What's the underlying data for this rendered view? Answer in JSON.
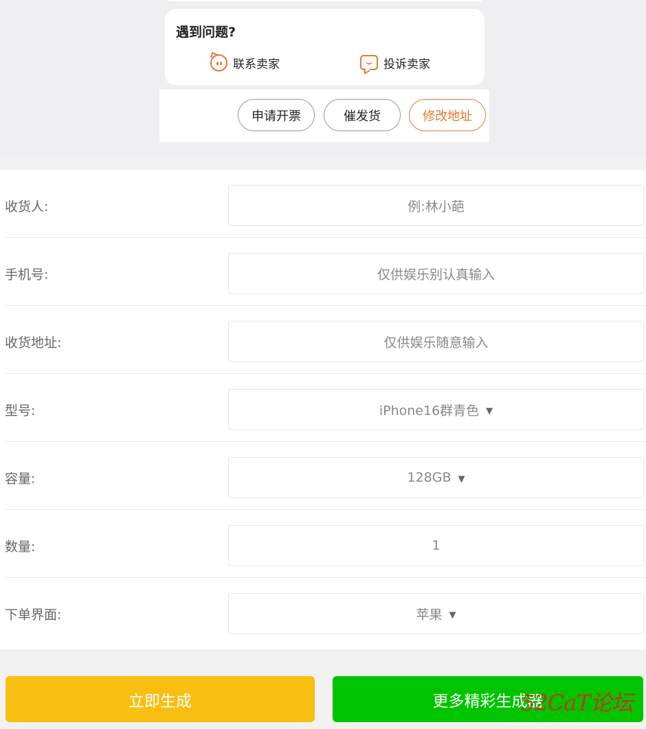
{
  "preview": {
    "problem_title": "遇到问题?",
    "contact_seller": "联系卖家",
    "complain_seller": "投诉卖家",
    "buttons": {
      "invoice": "申请开票",
      "urge": "催发货",
      "address": "修改地址"
    }
  },
  "form": {
    "rows": [
      {
        "label": "收货人:",
        "value": "例:林小葩"
      },
      {
        "label": "手机号:",
        "value": "仅供娱乐别认真输入"
      },
      {
        "label": "收货地址:",
        "value": "仅供娱乐随意输入"
      },
      {
        "label": "型号:",
        "value": "iPhone16群青色"
      },
      {
        "label": "容量:",
        "value": "128GB"
      },
      {
        "label": "数量:",
        "value": "1"
      },
      {
        "label": "下单界面:",
        "value": "苹果"
      }
    ]
  },
  "actions": {
    "generate": "立即生成",
    "more": "更多精彩生成器"
  },
  "watermark": "52CaT论坛",
  "colors": {
    "accent": "#e8762e",
    "generate": "#f8be12",
    "more": "#00c400"
  }
}
